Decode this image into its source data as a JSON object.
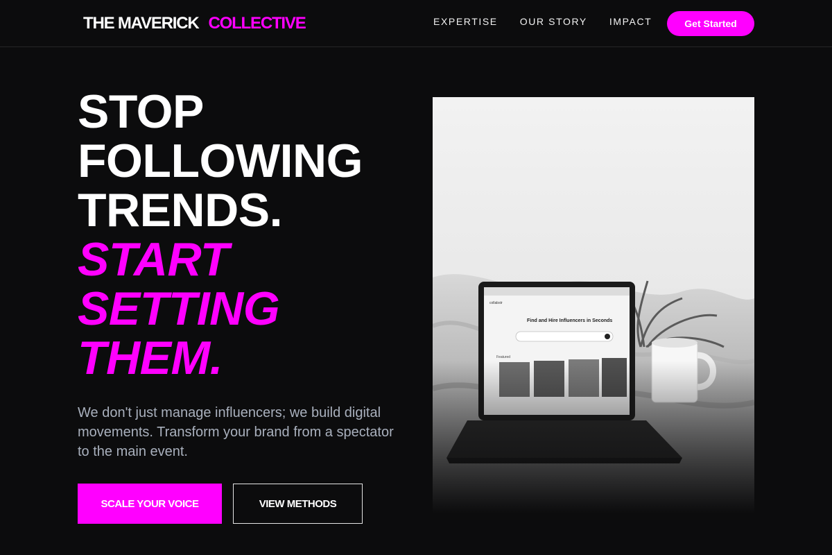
{
  "brand": {
    "part1": "THE MAVERICK",
    "part2": "COLLECTIVE"
  },
  "nav": {
    "items": [
      "EXPERTISE",
      "OUR STORY",
      "IMPACT"
    ]
  },
  "header_cta": "Get Started",
  "hero": {
    "headline_lines": [
      "STOP",
      "FOLLOWING",
      "TRENDS."
    ],
    "accent_lines": [
      "START",
      "SETTING",
      "THEM."
    ],
    "subtitle": "We don't just manage influencers; we build digital movements. Transform your brand from a spectator to the main event.",
    "primary_button": "SCALE YOUR VOICE",
    "secondary_button": "VIEW METHODS"
  },
  "hero_image": {
    "icon": "laptop-photo",
    "screen_logo": "collabstr",
    "screen_heading": "Find and Hire Influencers in Seconds",
    "screen_section": "Featured"
  },
  "colors": {
    "background": "#0c0c0d",
    "accent": "#ff00ff",
    "text": "#ffffff",
    "muted": "#a9b0bd"
  }
}
